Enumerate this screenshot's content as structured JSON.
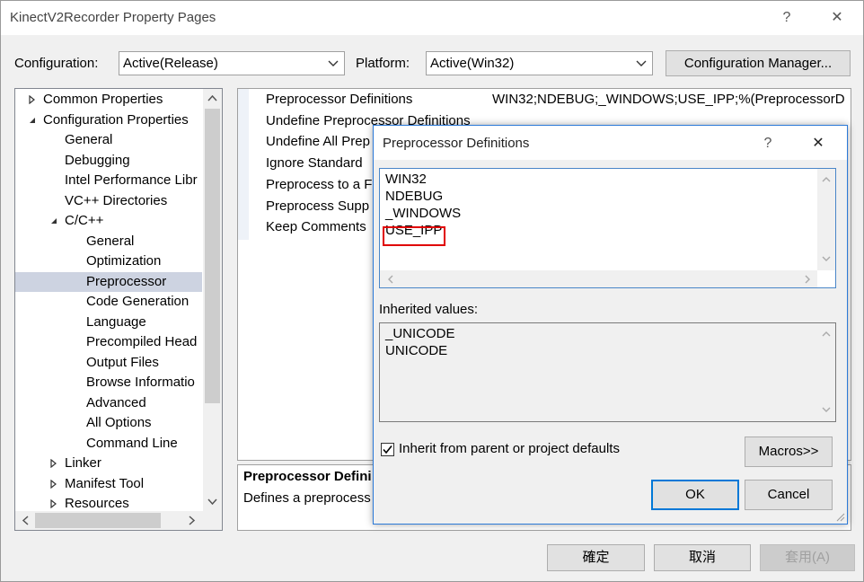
{
  "window": {
    "title": "KinectV2Recorder Property Pages",
    "help": "?",
    "close": "✕"
  },
  "config": {
    "configuration_label": "Configuration:",
    "configuration_value": "Active(Release)",
    "platform_label": "Platform:",
    "platform_value": "Active(Win32)",
    "manager_button": "Configuration Manager..."
  },
  "tree": {
    "items": [
      {
        "label": "Common Properties",
        "expander": "collapsed"
      },
      {
        "label": "Configuration Properties",
        "expander": "expanded"
      },
      {
        "label": "General"
      },
      {
        "label": "Debugging"
      },
      {
        "label": "Intel Performance Libr"
      },
      {
        "label": "VC++ Directories"
      },
      {
        "label": "C/C++",
        "expander": "expanded"
      },
      {
        "label": "General"
      },
      {
        "label": "Optimization"
      },
      {
        "label": "Preprocessor",
        "selected": true
      },
      {
        "label": "Code Generation"
      },
      {
        "label": "Language"
      },
      {
        "label": "Precompiled Head"
      },
      {
        "label": "Output Files"
      },
      {
        "label": "Browse Informatio"
      },
      {
        "label": "Advanced"
      },
      {
        "label": "All Options"
      },
      {
        "label": "Command Line"
      },
      {
        "label": "Linker",
        "expander": "collapsed"
      },
      {
        "label": "Manifest Tool",
        "expander": "collapsed"
      },
      {
        "label": "Resources",
        "expander": "collapsed"
      }
    ]
  },
  "grid": {
    "rows": [
      {
        "name": "Preprocessor Definitions",
        "value": "WIN32;NDEBUG;_WINDOWS;USE_IPP;%(PreprocessorD"
      },
      {
        "name": "Undefine Preprocessor Definitions",
        "value": ""
      },
      {
        "name": "Undefine All Prep",
        "value": ""
      },
      {
        "name": "Ignore Standard",
        "value": ""
      },
      {
        "name": "Preprocess to a F",
        "value": ""
      },
      {
        "name": "Preprocess Supp",
        "value": ""
      },
      {
        "name": "Keep Comments",
        "value": ""
      }
    ]
  },
  "description": {
    "title": "Preprocessor Defini",
    "text": "Defines a preprocess"
  },
  "dialog": {
    "title": "Preprocessor Definitions",
    "help": "?",
    "close": "✕",
    "lines": [
      "WIN32",
      "NDEBUG",
      "_WINDOWS",
      "USE_IPP"
    ],
    "inherited_label": "Inherited values:",
    "inherited_lines": [
      "_UNICODE",
      "UNICODE"
    ],
    "inherit_checkbox_label": "Inherit from parent or project defaults",
    "inherit_checked": true,
    "macros_button": "Macros>>",
    "ok_button": "OK",
    "cancel_button": "Cancel"
  },
  "footer": {
    "ok": "確定",
    "cancel": "取消",
    "apply": "套用(A)"
  },
  "colors": {
    "accent": "#0078d7",
    "highlight": "#cdd3e1",
    "annotation_red": "#e00000"
  }
}
